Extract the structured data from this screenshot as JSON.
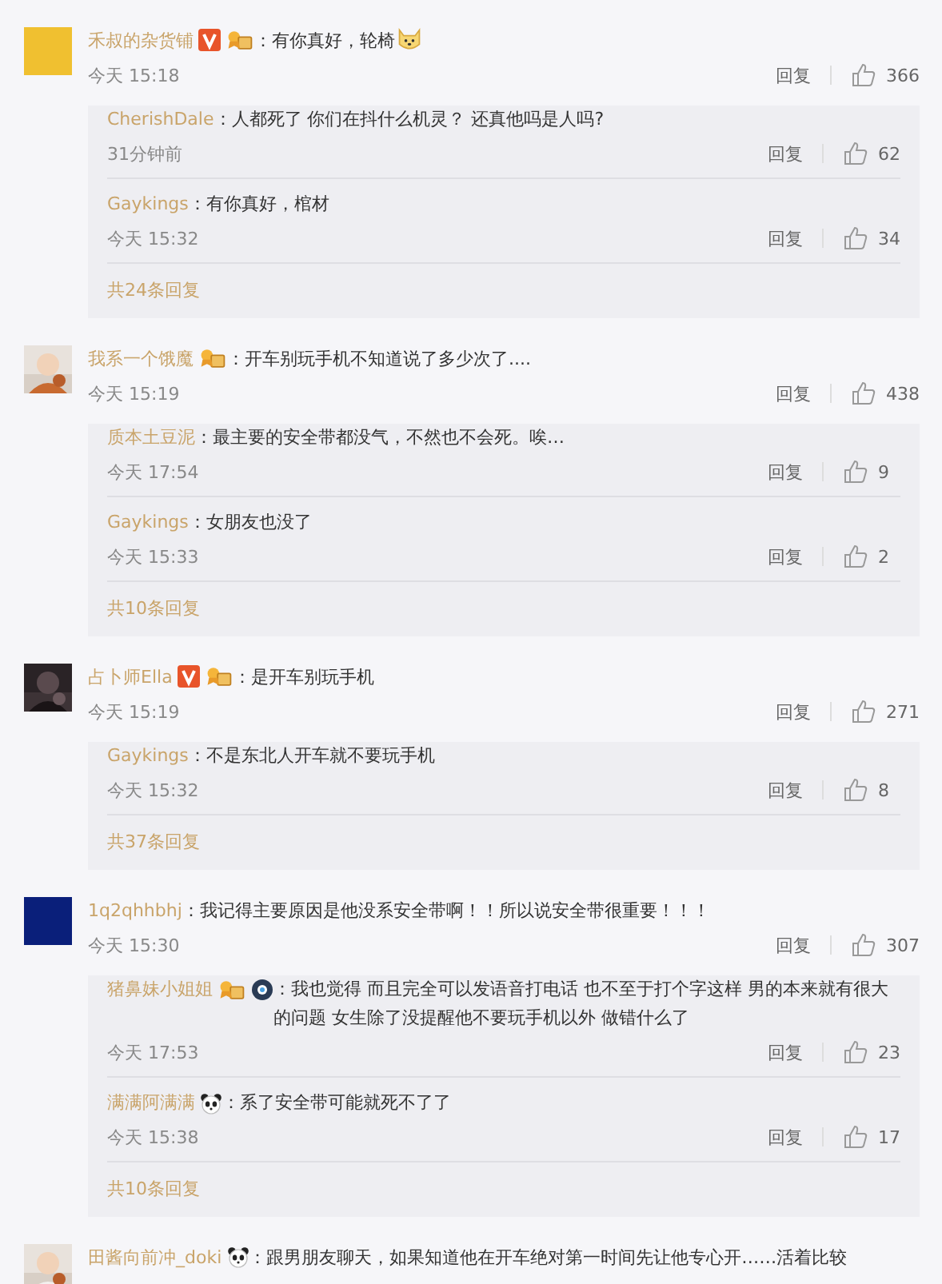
{
  "comments": [
    {
      "avatar": {
        "kind": "plain",
        "color": "#f0c030"
      },
      "user": "禾叔的杂货铺",
      "verified": true,
      "medal": true,
      "text": "：有你真好，轮椅",
      "dog_emoji": true,
      "time": "今天 15:18",
      "reply_label": "回复",
      "likes": "366",
      "replies": [
        {
          "user": "CherishDale",
          "text": "：人都死了 你们在抖什么机灵？ 还真他吗是人吗?",
          "time": "31分钟前",
          "reply_label": "回复",
          "likes": "62"
        },
        {
          "user": "Gaykings",
          "text": "：有你真好，棺材",
          "time": "今天 15:32",
          "reply_label": "回复",
          "likes": "34"
        }
      ],
      "more": "共24条回复"
    },
    {
      "avatar": {
        "kind": "picture"
      },
      "user": "我系一个饿魔",
      "medal": true,
      "text": "：开车别玩手机不知道说了多少次了....",
      "time": "今天 15:19",
      "reply_label": "回复",
      "likes": "438",
      "replies": [
        {
          "user": "质本土豆泥",
          "text": "：最主要的安全带都没气，不然也不会死。唉…",
          "time": "今天 17:54",
          "reply_label": "回复",
          "likes": "9"
        },
        {
          "user": "Gaykings",
          "text": "：女朋友也没了",
          "time": "今天 15:33",
          "reply_label": "回复",
          "likes": "2"
        }
      ],
      "more": "共10条回复"
    },
    {
      "avatar": {
        "kind": "picture"
      },
      "user": "占卜师Ella",
      "verified": true,
      "medal": true,
      "text": "：是开车别玩手机",
      "time": "今天 15:19",
      "reply_label": "回复",
      "likes": "271",
      "replies": [
        {
          "user": "Gaykings",
          "text": "：不是东北人开车就不要玩手机",
          "time": "今天 15:32",
          "reply_label": "回复",
          "likes": "8"
        }
      ],
      "more": "共37条回复"
    },
    {
      "avatar": {
        "kind": "plain",
        "color": "#0a1f7a"
      },
      "user": "1q2qhhbhj",
      "text": "：我记得主要原因是他没系安全带啊！！所以说安全带很重要！！！",
      "time": "今天 15:30",
      "reply_label": "回复",
      "likes": "307",
      "replies": [
        {
          "user": "猪鼻妹小姐姐",
          "medal": true,
          "disc_badge": true,
          "text": "：我也觉得 而且完全可以发语音打电话 也不至于打个字这样 男的本来就有很大的问题 女生除了没提醒他不要玩手机以外 做错什么了",
          "time": "今天 17:53",
          "reply_label": "回复",
          "likes": "23"
        },
        {
          "user": "满满阿满满",
          "panda_emoji": true,
          "text": "：系了安全带可能就死不了了",
          "time": "今天 15:38",
          "reply_label": "回复",
          "likes": "17"
        }
      ],
      "more": "共10条回复"
    },
    {
      "avatar": {
        "kind": "picture"
      },
      "user": "田酱向前冲_doki",
      "panda_emoji": true,
      "text": "：跟男朋友聊天，如果知道他在开车绝对第一时间先让他专心开……活着比较"
    }
  ]
}
